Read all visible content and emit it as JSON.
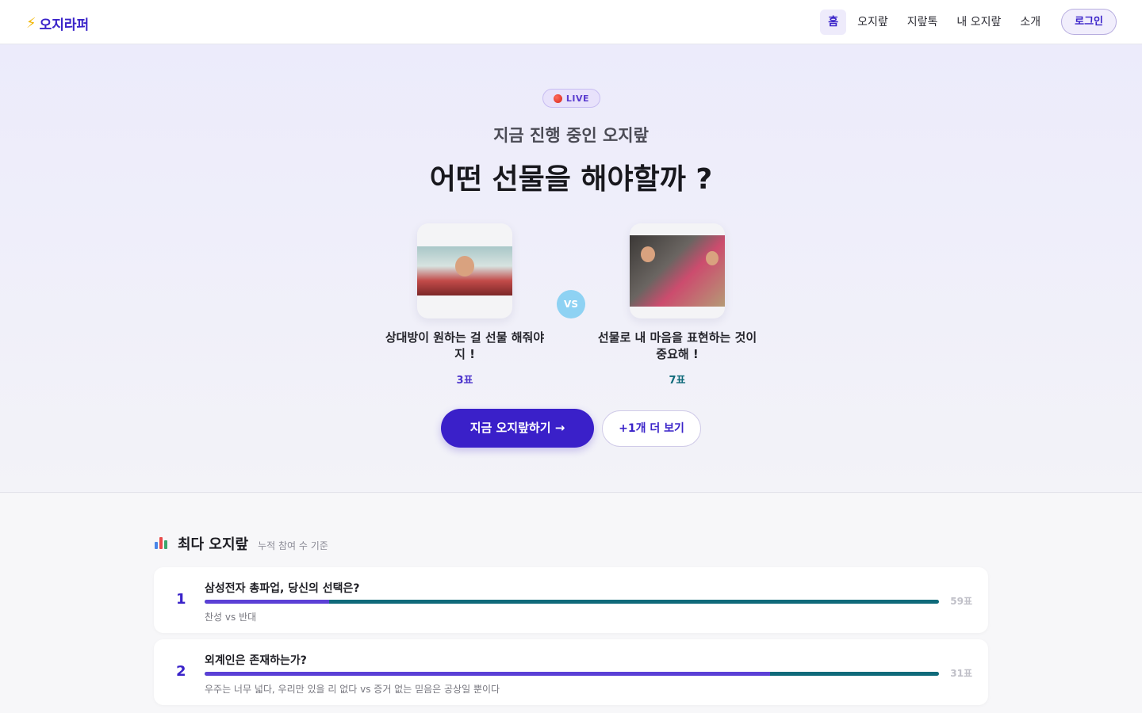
{
  "header": {
    "logo_text": "오지라퍼",
    "nav": [
      "홈",
      "오지랖",
      "지랖톡",
      "내 오지랖",
      "소개"
    ],
    "active_nav": "홈",
    "login_label": "로그인"
  },
  "hero": {
    "live_label": "LIVE",
    "subtitle": "지금 진행 중인 오지랖",
    "title": "어떤 선물을 해야할까 ?",
    "vs_label": "VS",
    "option_a": {
      "label": "상대방이 원하는 걸 선물 해줘야 지 !",
      "votes": "3표"
    },
    "option_b": {
      "label": "선물로 내 마음을 표현하는 것이 중요해 !",
      "votes": "7표"
    },
    "cta_label": "지금 오지랖하기 →",
    "more_label": "+1개 더 보기"
  },
  "ranking": {
    "title": "최다 오지랖",
    "subtitle": "누적 참여 수 기준",
    "items": [
      {
        "rank": "1",
        "question": "삼성전자 총파업, 당신의 선택은?",
        "options": "찬성 vs 반대",
        "votes": "59표",
        "option_a_share": 0.17
      },
      {
        "rank": "2",
        "question": "외계인은 존재하는가?",
        "options": "우주는 너무 넓다, 우리만 있을 리 없다 vs 증거 없는 믿음은 공상일 뿐이다",
        "votes": "31표",
        "option_a_share": 0.77
      }
    ]
  },
  "colors": {
    "brand": "#3a23c9",
    "bar_a": "#5b40d6",
    "bar_b": "#0f6a7a",
    "vs": "#8ed2f3",
    "live_dot": "#e0332a"
  }
}
